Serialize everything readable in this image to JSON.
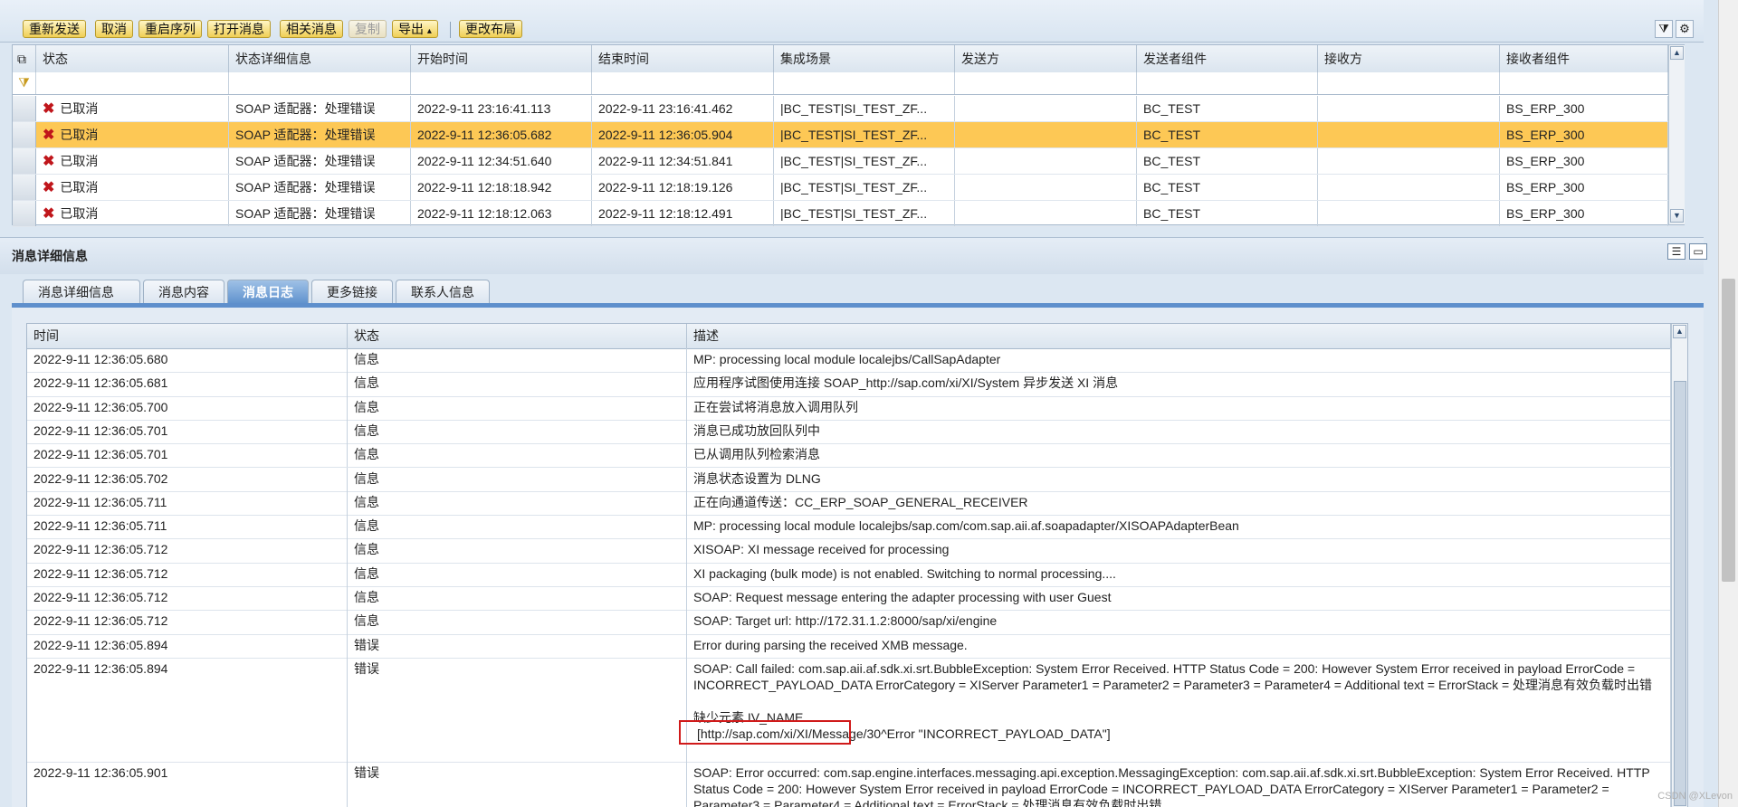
{
  "toolbar": {
    "buttons": [
      "重新发送",
      "取消",
      "重启序列",
      "打开消息",
      "相关消息",
      "复制",
      "导出",
      "更改布局"
    ],
    "export_arrow": "▴"
  },
  "messages_table": {
    "columns": [
      "状态",
      "状态详细信息",
      "开始时间",
      "结束时间",
      "集成场景",
      "发送方",
      "发送者组件",
      "接收方",
      "接收者组件"
    ],
    "rows": [
      {
        "status": "已取消",
        "detail": "SOAP 适配器：处理错误",
        "start": "2022-9-11 23:16:41.113",
        "end": "2022-9-11 23:16:41.462",
        "scenario": "|BC_TEST|SI_TEST_ZF...",
        "sender": "",
        "sender_component": "BC_TEST",
        "receiver": "",
        "receiver_component": "BS_ERP_300"
      },
      {
        "status": "已取消",
        "detail": "SOAP 适配器：处理错误",
        "start": "2022-9-11 12:36:05.682",
        "end": "2022-9-11 12:36:05.904",
        "scenario": "|BC_TEST|SI_TEST_ZF...",
        "sender": "",
        "sender_component": "BC_TEST",
        "receiver": "",
        "receiver_component": "BS_ERP_300"
      },
      {
        "status": "已取消",
        "detail": "SOAP 适配器：处理错误",
        "start": "2022-9-11 12:34:51.640",
        "end": "2022-9-11 12:34:51.841",
        "scenario": "|BC_TEST|SI_TEST_ZF...",
        "sender": "",
        "sender_component": "BC_TEST",
        "receiver": "",
        "receiver_component": "BS_ERP_300"
      },
      {
        "status": "已取消",
        "detail": "SOAP 适配器：处理错误",
        "start": "2022-9-11 12:18:18.942",
        "end": "2022-9-11 12:18:19.126",
        "scenario": "|BC_TEST|SI_TEST_ZF...",
        "sender": "",
        "sender_component": "BC_TEST",
        "receiver": "",
        "receiver_component": "BS_ERP_300"
      },
      {
        "status": "已取消",
        "detail": "SOAP 适配器：处理错误",
        "start": "2022-9-11 12:18:12.063",
        "end": "2022-9-11 12:18:12.491",
        "scenario": "|BC_TEST|SI_TEST_ZF...",
        "sender": "",
        "sender_component": "BC_TEST",
        "receiver": "",
        "receiver_component": "BS_ERP_300"
      }
    ]
  },
  "detail_panel": {
    "title": "消息详细信息",
    "tabs": [
      "消息详细信息",
      "消息内容",
      "消息日志",
      "更多链接",
      "联系人信息"
    ],
    "active_tab": "消息日志"
  },
  "log_table": {
    "columns": [
      "时间",
      "状态",
      "描述"
    ],
    "rows": [
      {
        "time": "2022-9-11 12:36:05.680",
        "status": "信息",
        "desc": "MP: processing local module localejbs/CallSapAdapter"
      },
      {
        "time": "2022-9-11 12:36:05.681",
        "status": "信息",
        "desc": "应用程序试图使用连接 SOAP_http://sap.com/xi/XI/System 异步发送 XI 消息"
      },
      {
        "time": "2022-9-11 12:36:05.700",
        "status": "信息",
        "desc": "正在尝试将消息放入调用队列"
      },
      {
        "time": "2022-9-11 12:36:05.701",
        "status": "信息",
        "desc": "消息已成功放回队列中"
      },
      {
        "time": "2022-9-11 12:36:05.701",
        "status": "信息",
        "desc": "已从调用队列检索消息"
      },
      {
        "time": "2022-9-11 12:36:05.702",
        "status": "信息",
        "desc": "消息状态设置为 DLNG"
      },
      {
        "time": "2022-9-11 12:36:05.711",
        "status": "信息",
        "desc": "正在向通道传送：CC_ERP_SOAP_GENERAL_RECEIVER"
      },
      {
        "time": "2022-9-11 12:36:05.711",
        "status": "信息",
        "desc": "MP: processing local module localejbs/sap.com/com.sap.aii.af.soapadapter/XISOAPAdapterBean"
      },
      {
        "time": "2022-9-11 12:36:05.712",
        "status": "信息",
        "desc": "XISOAP: XI message received for processing"
      },
      {
        "time": "2022-9-11 12:36:05.712",
        "status": "信息",
        "desc": "XI packaging (bulk mode) is not enabled. Switching to normal processing...."
      },
      {
        "time": "2022-9-11 12:36:05.712",
        "status": "信息",
        "desc": "SOAP: Request message entering the adapter processing with user Guest"
      },
      {
        "time": "2022-9-11 12:36:05.712",
        "status": "信息",
        "desc": "SOAP: Target url: http://172.31.1.2:8000/sap/xi/engine"
      },
      {
        "time": "2022-9-11 12:36:05.894",
        "status": "错误",
        "desc": "Error during parsing the received XMB message."
      }
    ],
    "error_row": {
      "time": "2022-9-11 12:36:05.894",
      "status": "错误",
      "desc_main": "SOAP: Call failed: com.sap.aii.af.sdk.xi.srt.BubbleException: System Error Received. HTTP Status Code = 200: However System Error received in payload ErrorCode = INCORRECT_PAYLOAD_DATA ErrorCategory = XIServer Parameter1 =  Parameter2 =  Parameter3 =  Parameter4 =  Additional text =  ErrorStack = 处理消息有效负载时出错",
      "desc_highlight": "缺少元素 IV_NAME",
      "desc_tail": "[http://sap.com/xi/XI/Message/30^Error \"INCORRECT_PAYLOAD_DATA\"]"
    },
    "last_row": {
      "time": "2022-9-11 12:36:05.901",
      "status": "错误",
      "desc": "SOAP: Error occurred: com.sap.engine.interfaces.messaging.api.exception.MessagingException: com.sap.aii.af.sdk.xi.srt.BubbleException: System Error Received. HTTP Status Code = 200: However System Error received in payload ErrorCode = INCORRECT_PAYLOAD_DATA ErrorCategory = XIServer Parameter1 =  Parameter2 =  Parameter3 =  Parameter4 =  Additional text =  ErrorStack = 处理消息有效负载时出错"
    }
  },
  "watermark": "CSDN @XLevon",
  "colors": {
    "selected_row": "#fdc855",
    "error_x": "#c0161b",
    "highlight_box": "#d01a1a",
    "active_tab": "#5e91cd"
  }
}
